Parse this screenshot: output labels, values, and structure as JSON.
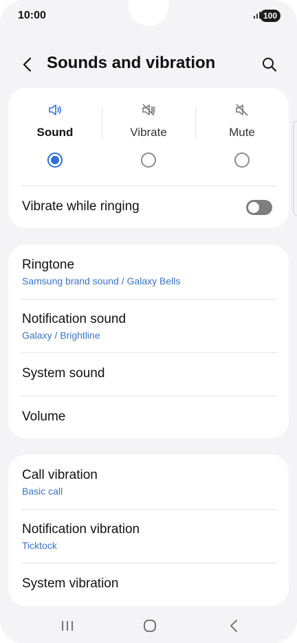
{
  "status_bar": {
    "time": "10:00",
    "battery": "100",
    "signal_icon": "signal-bars-icon"
  },
  "header": {
    "title": "Sounds and vibration",
    "back_icon": "chevron-left-icon",
    "search_icon": "search-icon"
  },
  "sound_mode": {
    "options": [
      {
        "label": "Sound",
        "icon": "speaker-icon",
        "selected": true
      },
      {
        "label": "Vibrate",
        "icon": "vibrate-icon",
        "selected": false
      },
      {
        "label": "Mute",
        "icon": "mute-icon",
        "selected": false
      }
    ],
    "vibrate_while_ringing": {
      "label": "Vibrate while ringing",
      "enabled": false
    }
  },
  "sound_settings": [
    {
      "title": "Ringtone",
      "subtitle": "Samsung brand sound / Galaxy Bells"
    },
    {
      "title": "Notification sound",
      "subtitle": "Galaxy / Brightline"
    },
    {
      "title": "System sound"
    },
    {
      "title": "Volume"
    }
  ],
  "vibration_settings": [
    {
      "title": "Call vibration",
      "subtitle": "Basic call"
    },
    {
      "title": "Notification vibration",
      "subtitle": "Ticktock"
    },
    {
      "title": "System vibration"
    }
  ],
  "colors": {
    "accent": "#2f6fd6",
    "subtitle": "#3a73c4",
    "background": "#f4f4f7",
    "card": "#ffffff"
  },
  "navigation": {
    "icons": [
      "recents-icon",
      "home-icon",
      "back-icon"
    ]
  }
}
